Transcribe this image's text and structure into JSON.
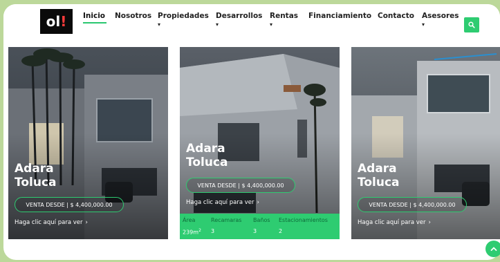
{
  "nav": {
    "logo_text": "ol",
    "logo_mark": "!",
    "items": [
      {
        "label": "Inicio",
        "dropdown": false
      },
      {
        "label": "Nosotros",
        "dropdown": false
      },
      {
        "label": "Propiedades",
        "dropdown": true
      },
      {
        "label": "Desarrollos",
        "dropdown": true
      },
      {
        "label": "Rentas",
        "dropdown": true
      },
      {
        "label": "Financiamiento",
        "dropdown": false
      },
      {
        "label": "Contacto",
        "dropdown": false
      },
      {
        "label": "Asesores",
        "dropdown": true
      }
    ],
    "caret": "▾",
    "search_icon": "search-icon"
  },
  "cards": [
    {
      "title_line1": "Adara",
      "title_line2": "Toluca",
      "price": "VENTA DESDE | $ 4,400,000.00",
      "cta": "Haga clic aquí para ver",
      "cta_arrow": "›"
    },
    {
      "title_line1": "Adara",
      "title_line2": "Toluca",
      "price": "VENTA DESDE | $ 4,400,000.00",
      "cta": "Haga clic aquí para ver",
      "cta_arrow": "›",
      "stats": {
        "area_label": "Área",
        "area_value": "239m",
        "area_unit": "2",
        "recamaras_label": "Recamaras",
        "recamaras_value": "3",
        "banos_label": "Baños",
        "banos_value": "3",
        "estacionamientos_label": "Estacionamientos",
        "estacionamientos_value": "2"
      }
    },
    {
      "title_line1": "Adara",
      "title_line2": "Toluca",
      "price": "VENTA DESDE | $ 4,400,000.00",
      "cta": "Haga clic aquí para ver",
      "cta_arrow": "›"
    }
  ],
  "colors": {
    "accent": "#2ecc71",
    "page_bg": "#bcd89a"
  },
  "scroll_top_icon": "chevron-up-icon"
}
